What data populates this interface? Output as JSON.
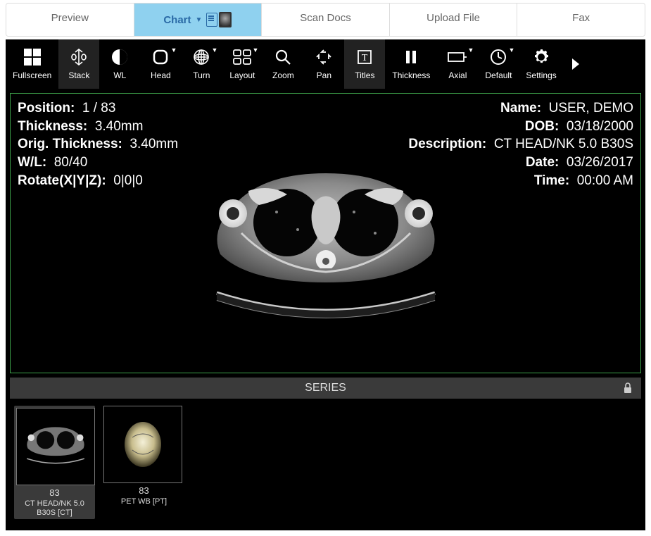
{
  "tabs": {
    "preview": "Preview",
    "chart": "Chart",
    "scan_docs": "Scan Docs",
    "upload_file": "Upload File",
    "fax": "Fax"
  },
  "toolbar": {
    "fullscreen": "Fullscreen",
    "stack": "Stack",
    "wl": "WL",
    "head": "Head",
    "turn": "Turn",
    "layout": "Layout",
    "zoom": "Zoom",
    "pan": "Pan",
    "titles": "Titles",
    "thickness": "Thickness",
    "axial": "Axial",
    "default": "Default",
    "settings": "Settings"
  },
  "overlay": {
    "left": {
      "position_label": "Position:",
      "position_value": "1 / 83",
      "thickness_label": "Thickness:",
      "thickness_value": "3.40mm",
      "orig_thickness_label": "Orig. Thickness:",
      "orig_thickness_value": "3.40mm",
      "wl_label": "W/L:",
      "wl_value": "80/40",
      "rotate_label": "Rotate(X|Y|Z):",
      "rotate_value": "0|0|0"
    },
    "right": {
      "name_label": "Name:",
      "name_value": "USER, DEMO",
      "dob_label": "DOB:",
      "dob_value": "03/18/2000",
      "desc_label": "Description:",
      "desc_value": "CT HEAD/NK 5.0 B30S",
      "date_label": "Date:",
      "date_value": "03/26/2017",
      "time_label": "Time:",
      "time_value": "00:00 AM"
    }
  },
  "series": {
    "header": "SERIES",
    "items": [
      {
        "count": "83",
        "name": "CT HEAD/NK 5.0 B30S [CT]"
      },
      {
        "count": "83",
        "name": "PET WB [PT]"
      }
    ]
  }
}
